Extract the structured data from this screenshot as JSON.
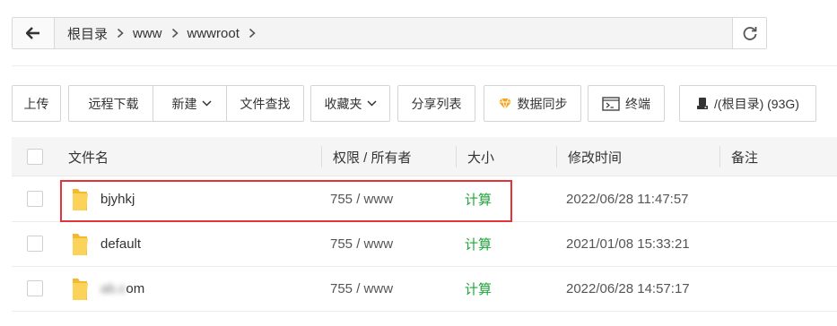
{
  "breadcrumb": {
    "items": [
      "根目录",
      "www",
      "wwwroot"
    ]
  },
  "toolbar": {
    "upload": "上传",
    "remote_download": "远程下载",
    "new": "新建",
    "file_search": "文件查找",
    "favorites": "收藏夹",
    "share_list": "分享列表",
    "data_sync": "数据同步",
    "terminal": "终端",
    "disk": "/(根目录) (93G)"
  },
  "table": {
    "headers": {
      "name": "文件名",
      "permission": "权限 / 所有者",
      "size": "大小",
      "modified": "修改时间",
      "remark": "备注"
    },
    "rows": [
      {
        "name": "bjyhkj",
        "permission": "755 / www",
        "size": "计算",
        "modified": "2022/06/28 11:47:57"
      },
      {
        "name": "default",
        "permission": "755 / www",
        "size": "计算",
        "modified": "2021/01/08 15:33:21"
      },
      {
        "name": "om",
        "name_blurred_prefix": "ab.c",
        "permission": "755 / www",
        "size": "计算",
        "modified": "2022/06/28 14:57:17"
      }
    ]
  },
  "colors": {
    "accent_green": "#20a53a",
    "highlight_red": "#e5333a",
    "folder_yellow": "#f7c948"
  },
  "icons": {
    "back": "arrow-left-icon",
    "refresh": "refresh-icon",
    "breadcrumb_separator": "chevron-right-icon",
    "data_sync": "diamond-icon",
    "terminal": "terminal-icon",
    "disk": "disk-icon",
    "folder": "folder-icon"
  }
}
